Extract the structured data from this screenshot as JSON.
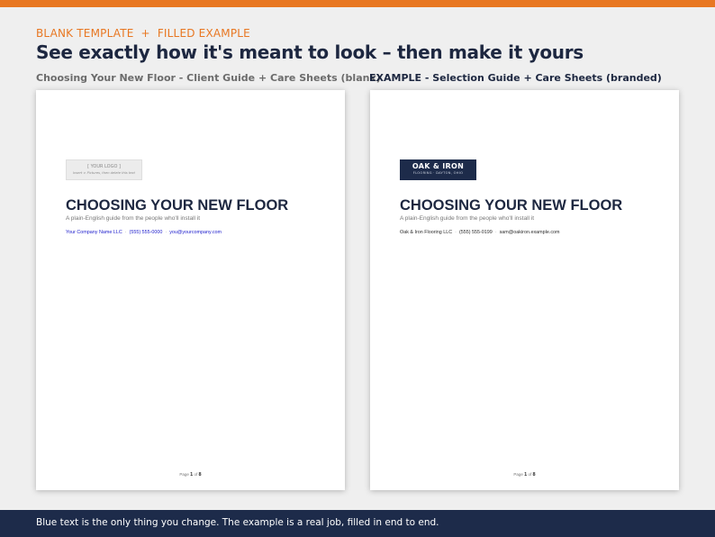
{
  "header": {
    "eyebrow": "BLANK TEMPLATE  +  FILLED EXAMPLE",
    "headline": "See exactly how it's meant to look – then make it yours"
  },
  "left_column": {
    "label": "Choosing Your New Floor - Client Guide + Care Sheets (blank)",
    "page": {
      "logo_line1": "[ YOUR LOGO ]",
      "logo_line2": "Insert > Pictures, then delete this text",
      "title": "CHOOSING YOUR NEW FLOOR",
      "subtitle": "A plain-English guide from the people who'll install it",
      "contact": {
        "company": "Your Company Name LLC",
        "phone": "(555) 555-0000",
        "email": "you@yourcompany.com",
        "separator": "·"
      },
      "footer": {
        "page_word": "Page",
        "page_num": "1",
        "of_word": "of",
        "total": "8"
      }
    }
  },
  "right_column": {
    "label": "EXAMPLE - Selection Guide + Care Sheets (branded)",
    "page": {
      "logo_line1": "OAK & IRON",
      "logo_line2": "FLOORING  ·  DAYTON, OHIO",
      "title": "CHOOSING YOUR NEW FLOOR",
      "subtitle": "A plain-English guide from the people who'll install it",
      "contact": {
        "company": "Oak & Iron Flooring LLC",
        "phone": "(555) 555-0199",
        "email": "sam@oakiron.example.com",
        "separator": "·"
      },
      "footer": {
        "page_word": "Page",
        "page_num": "1",
        "of_word": "of",
        "total": "8"
      }
    }
  },
  "footer_bar": {
    "text": "Blue text is the only thing you change. The example is a real job, filled in end to end."
  },
  "colors": {
    "accent_orange": "#e87722",
    "navy": "#1d2b4a",
    "editable_blue": "#1a1acc"
  }
}
